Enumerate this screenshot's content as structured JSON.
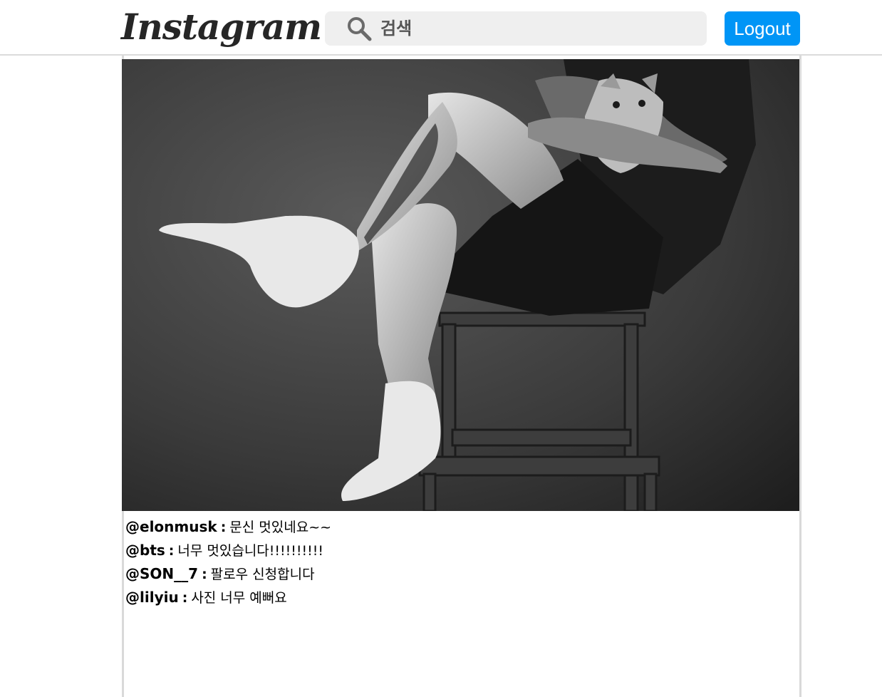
{
  "header": {
    "logo_text": "Instagram",
    "search_placeholder": "검색",
    "search_value": "",
    "logout_label": "Logout"
  },
  "post": {
    "username": "",
    "photo_description_icon": "photo-of-person-with-cat",
    "comments": [
      {
        "user": "@elonmusk",
        "sep": ":",
        "text": "문신 멋있네요~~"
      },
      {
        "user": "@bts",
        "sep": ":",
        "text": "너무 멋있습니다!!!!!!!!!!"
      },
      {
        "user": "@SON__7",
        "sep": ":",
        "text": "팔로우 신청합니다"
      },
      {
        "user": "@lilyiu",
        "sep": ":",
        "text": "사진 너무 예뻐요"
      }
    ]
  },
  "colors": {
    "accent": "#0095f6",
    "search_bg": "#efefef",
    "border": "#dbdbdb"
  }
}
